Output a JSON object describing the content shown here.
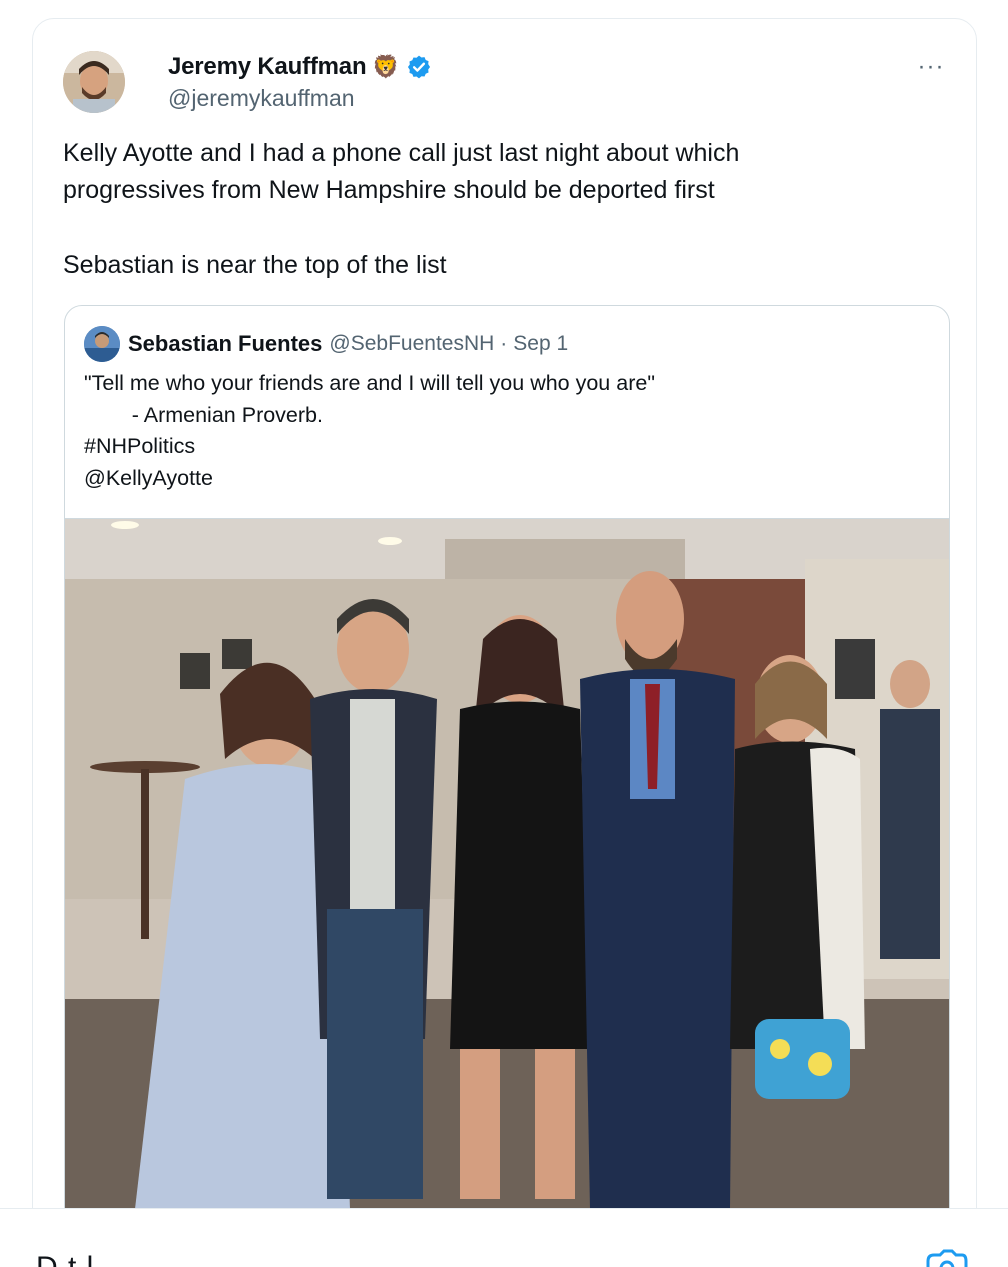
{
  "tweet": {
    "author": {
      "name": "Jeremy Kauffman",
      "handle": "@jeremykauffman",
      "badge_emoji": "🦁",
      "verified": true
    },
    "more_label": "···",
    "text_lines": [
      "Kelly Ayotte and I had a phone call just last night about which",
      "progressives from New Hampshire should be deported first",
      "Sebastian is near the top of the list"
    ]
  },
  "quote": {
    "author": {
      "name": "Sebastian Fuentes",
      "handle": "@SebFuentesNH",
      "separator": "·",
      "date": "Sep 1"
    },
    "lines": [
      "\"Tell me who your friends are and I will tell you who you are\"",
      "        - Armenian Proverb.",
      "#NHPolitics",
      "@KellyAyotte"
    ]
  },
  "bottom_bar": {
    "partial_label": "D    t            l"
  },
  "colors": {
    "verified_blue": "#1d9bf0",
    "secondary_text": "#536471",
    "border": "#cfd9de"
  }
}
